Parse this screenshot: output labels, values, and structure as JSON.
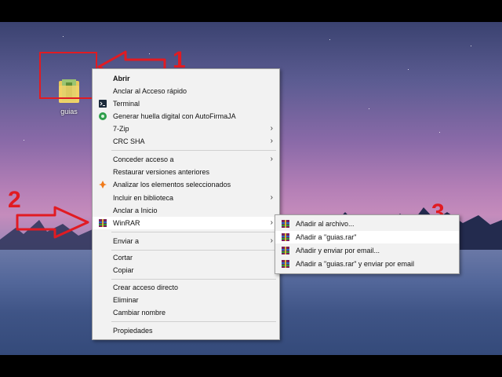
{
  "desktop": {
    "icon_label": "guias",
    "icon_name": "rar-folder-icon"
  },
  "context_menu": {
    "items": [
      {
        "label": "Abrir",
        "bold": true
      },
      {
        "label": "Anclar al Acceso rápido"
      },
      {
        "label": "Terminal",
        "icon": "terminal-icon"
      },
      {
        "label": "Generar huella digital con AutoFirmaJA",
        "icon": "autofirma-icon"
      },
      {
        "label": "7-Zip",
        "submenu": true
      },
      {
        "label": "CRC SHA",
        "submenu": true
      },
      {
        "label": "Conceder acceso a",
        "submenu": true
      },
      {
        "label": "Restaurar versiones anteriores"
      },
      {
        "label": "Analizar los elementos seleccionados",
        "icon": "avast-icon"
      },
      {
        "label": "Incluir en biblioteca",
        "submenu": true
      },
      {
        "label": "Anclar a Inicio"
      },
      {
        "label": "WinRAR",
        "submenu": true,
        "icon": "winrar-icon"
      },
      {
        "label": "Enviar a",
        "submenu": true
      },
      {
        "label": "Cortar"
      },
      {
        "label": "Copiar"
      },
      {
        "label": "Crear acceso directo"
      },
      {
        "label": "Eliminar"
      },
      {
        "label": "Cambiar nombre"
      },
      {
        "label": "Propiedades"
      }
    ]
  },
  "submenu": {
    "items": [
      {
        "label": "Añadir al archivo...",
        "icon": "winrar-icon"
      },
      {
        "label": "Añadir a \"guias.rar\"",
        "icon": "winrar-icon"
      },
      {
        "label": "Añadir y enviar por email...",
        "icon": "winrar-icon"
      },
      {
        "label": "Añadir a \"guias.rar\" y enviar por email",
        "icon": "winrar-icon"
      }
    ]
  },
  "annotations": {
    "step1": "1",
    "step2": "2",
    "step3": "3",
    "color": "#e11b22"
  },
  "arrow_glyph": "›"
}
